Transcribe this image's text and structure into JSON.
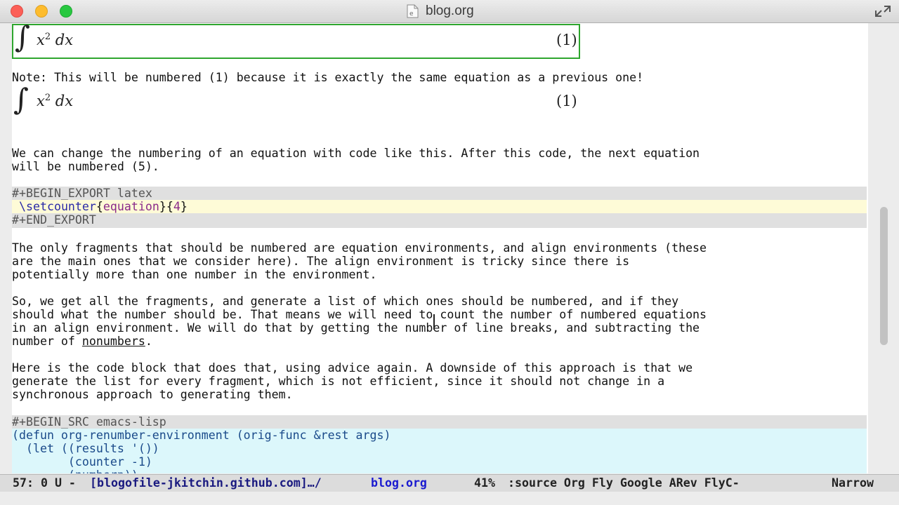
{
  "window": {
    "title": "blog.org"
  },
  "buffer": {
    "eq1_number": "(1)",
    "note_line": "Note: This will be numbered (1) because it is exactly the same equation as a previous one!",
    "eq2_number": "(1)",
    "para1": [
      "We can change the numbering of an equation with code like this. After this code, the next equation",
      "will be numbered (5)."
    ],
    "export_begin": "#+BEGIN_EXPORT latex",
    "setcounter": {
      "command": "\\setcounter",
      "open1": "{",
      "arg1": "equation",
      "mid": "}{",
      "arg2": "4",
      "close": "}"
    },
    "export_end": "#+END_EXPORT",
    "para2": [
      "The only fragments that should be numbered are equation environments, and align environments (these",
      "are the main ones that we consider here). The align environment is tricky since there is",
      "potentially more than one number in the environment."
    ],
    "para3": [
      "So, we get all the fragments, and generate a list of which ones should be numbered, and if they",
      "should what the number should be. That means we will need to count the number of numbered equations",
      "in an align environment. We will do that by getting the number of line breaks, and subtracting the"
    ],
    "para3_last_prefix": "number of ",
    "para3_link": "nonumbers",
    "para3_last_suffix": ".",
    "para4": [
      "Here is the code block that does that, using advice again. A downside of this approach is that we",
      "generate the list for every fragment, which is not efficient, since it should not change in a",
      "synchronous approach to generating them."
    ],
    "src_begin": "#+BEGIN_SRC emacs-lisp",
    "code": [
      "(defun org-renumber-environment (orig-func &rest args)",
      "  (let ((results '())",
      "        (counter -1)",
      "        (numberp))"
    ]
  },
  "modeline": {
    "position": "57: 0 U -",
    "buffer_path": "[blogofile-jkitchin.github.com]…/",
    "buffer_name": "blog.org",
    "percent": "41%",
    "modes": ":source Org Fly Google ARev FlyC-",
    "narrow": "Narrow"
  },
  "colors": {
    "link": "#1a1ad0",
    "keyword": "#2a2aa8",
    "string": "#8a2a8a",
    "eqbox": "#2ea62e"
  }
}
